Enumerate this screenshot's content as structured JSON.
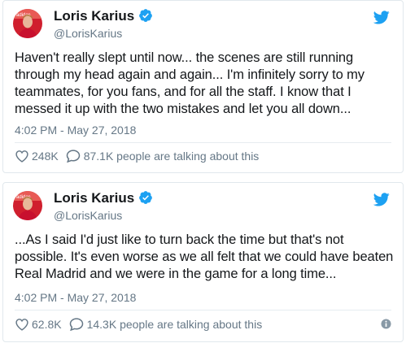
{
  "tweets": [
    {
      "author_name": "Loris Karius",
      "author_handle": "@LorisKarius",
      "text_lines": [
        "Haven't really slept until now... the scenes are still running",
        "through my head again and again... I'm infinitely sorry to my",
        "teammates, for you fans, and for all the staff. I know that I",
        "messed it up with the two mistakes and let you all down..."
      ],
      "timestamp": "4:02 PM - May 27, 2018",
      "likes": "248K",
      "replies_text": "87.1K people are talking about this"
    },
    {
      "author_name": "Loris Karius",
      "author_handle": "@LorisKarius",
      "text_lines": [
        "...As I said I'd just like to turn back the time but that's not",
        "possible. It's even worse as we all felt that we could have beaten",
        "Real Madrid and we were in the game for a long time..."
      ],
      "timestamp": "4:02 PM - May 27, 2018",
      "likes": "62.8K",
      "replies_text": "14.3K people are talking about this"
    }
  ],
  "colors": {
    "verified_blue": "#1da1f2",
    "twitter_blue": "#1da1f2",
    "meta_gray": "#657786",
    "avatar_red": "#d01f2e"
  },
  "icons": {
    "verified": "verified-badge-icon",
    "bird": "twitter-bird-icon",
    "like": "heart-icon",
    "reply": "speech-bubble-icon",
    "info": "info-icon"
  }
}
